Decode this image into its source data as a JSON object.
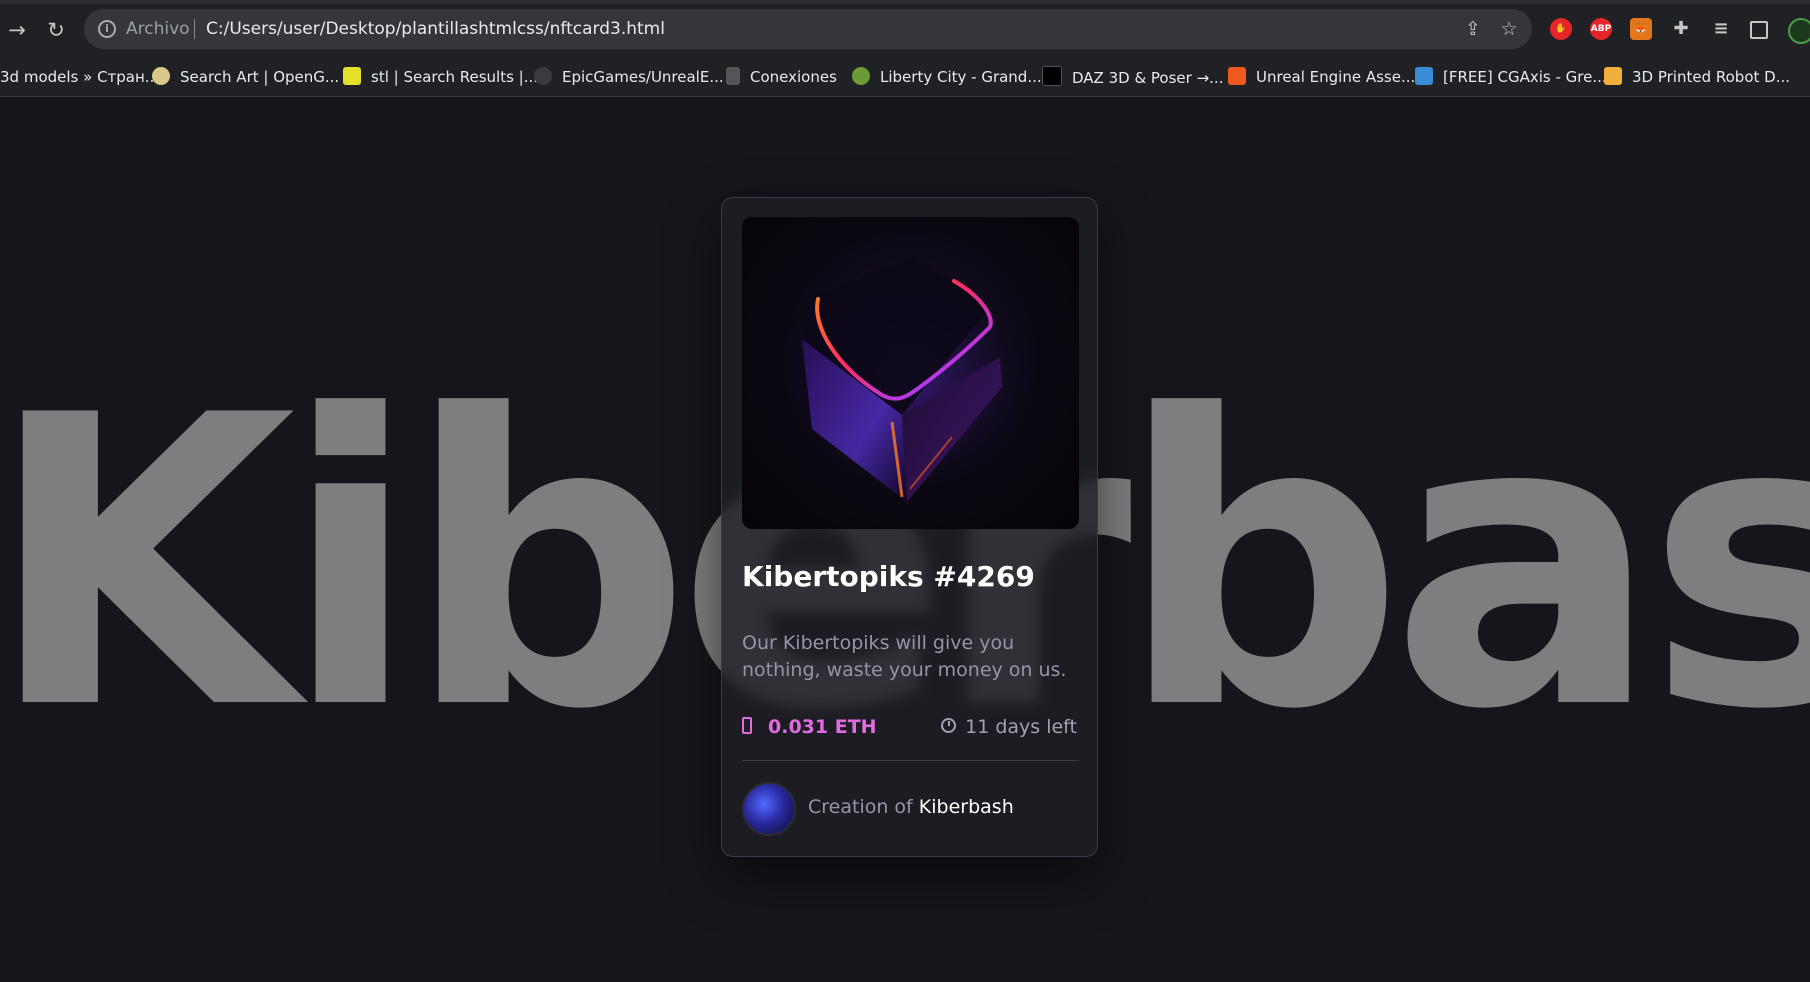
{
  "browser": {
    "nav": {
      "forward_icon": "arrow-right-icon",
      "reload_icon": "reload-icon"
    },
    "address": {
      "scheme_label": "Archivo",
      "url": "C:/Users/user/Desktop/plantillashtmlcss/nftcard3.html"
    },
    "extensions": [
      {
        "name": "adblock-icon",
        "label": "",
        "color": "#e5252a"
      },
      {
        "name": "abp-icon",
        "label": "ABP",
        "color": "#e5252a"
      },
      {
        "name": "metamask-icon",
        "label": "",
        "color": "#e2761b"
      }
    ],
    "bookmarks": [
      {
        "label": "3d models » Стран...",
        "icon": "bookmark-favicon",
        "color": ""
      },
      {
        "label": "Search Art | OpenG...",
        "icon": "skull-favicon",
        "color": "#d8c98a"
      },
      {
        "label": "stl | Search Results |...",
        "icon": "thingiverse-favicon",
        "color": "#e4e02a"
      },
      {
        "label": "EpicGames/UnrealE...",
        "icon": "github-favicon",
        "color": "#3a3b3e"
      },
      {
        "label": "Conexiones",
        "icon": "epic-favicon",
        "color": "#555"
      },
      {
        "label": "Liberty City - Grand...",
        "icon": "gta-favicon",
        "color": "#6a9a3a"
      },
      {
        "label": "DAZ 3D & Poser →...",
        "icon": "daz-favicon",
        "color": "#000"
      },
      {
        "label": "Unreal Engine Asse...",
        "icon": "unreal-favicon",
        "color": "#f05a1c"
      },
      {
        "label": "[FREE] CGAxis - Gre...",
        "icon": "cgaxis-favicon",
        "color": "#3a8bd8"
      },
      {
        "label": "3D Printed Robot D...",
        "icon": "robot-favicon",
        "color": "#f0b040"
      }
    ]
  },
  "page": {
    "watermark": "Kiberbash"
  },
  "card": {
    "image_alt_icon": "crystal-cube-icon",
    "title": "Kibertopiks #4269",
    "description": "Our Kibertopiks will give you nothing, waste your money on us.",
    "price": "0.031 ETH",
    "time_left": "11 days left",
    "creator_prefix": "Creation of",
    "creator_name": "Kiberbash",
    "accent_color": "#e06ce0"
  }
}
